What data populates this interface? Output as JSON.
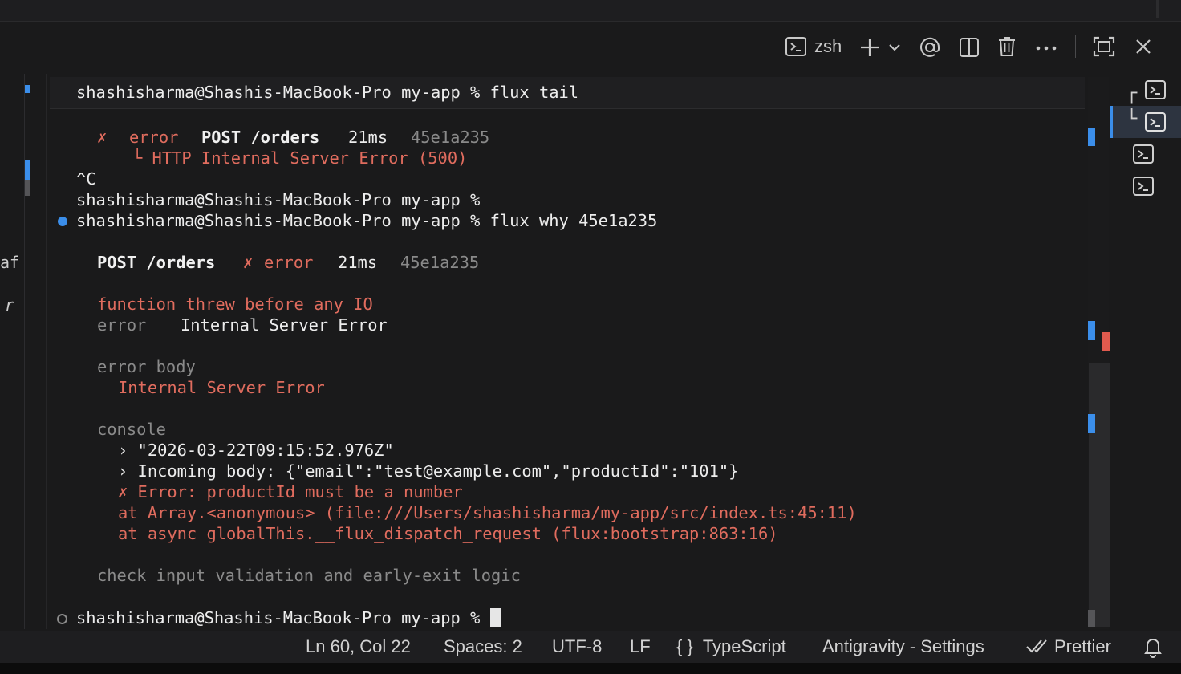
{
  "toolbar": {
    "shell_label": "zsh",
    "new_icon": "plus-icon",
    "dropdown_icon": "chevron-down-icon",
    "mention_icon": "at-icon",
    "split_icon": "split-icon",
    "trash_icon": "trash-icon",
    "more_icon": "ellipsis-icon",
    "maximize_icon": "maximize-icon",
    "close_icon": "close-icon"
  },
  "editor_edge": {
    "fragment_1": "af",
    "fragment_2": "r"
  },
  "terminal": {
    "sticky_prompt": "shashisharma@Shashis-MacBook-Pro my-app % flux tail",
    "tail": {
      "mark": "✗",
      "status": "error",
      "method_path": "POST /orders",
      "duration": "21ms",
      "id": "45e1a235",
      "detail": "└ HTTP Internal Server Error (500)"
    },
    "interrupt": "^C",
    "prompt_empty": "shashisharma@Shashis-MacBook-Pro my-app %",
    "prompt_why": "shashisharma@Shashis-MacBook-Pro my-app % flux why 45e1a235",
    "why": {
      "method_path": "POST /orders",
      "mark": "✗",
      "status": "error",
      "duration": "21ms",
      "id": "45e1a235",
      "headline": "function threw before any IO",
      "error_label": "error",
      "error_value": "Internal Server Error",
      "error_body_label": "error body",
      "error_body_value": "Internal Server Error",
      "console_label": "console",
      "console_1": "› \"2026-03-22T09:15:52.976Z\"",
      "console_2": "› Incoming body: {\"email\":\"test@example.com\",\"productId\":\"101\"}",
      "console_err": "✗ Error: productId must be a number",
      "stack_1": "at Array.<anonymous> (file:///Users/shashisharma/my-app/src/index.ts:45:11)",
      "stack_2": "at async globalThis.__flux_dispatch_request (flux:bootstrap:863:16)",
      "hint": "check input validation and early-exit logic"
    },
    "final_prompt": "shashisharma@Shashis-MacBook-Pro my-app %"
  },
  "terminal_list": {
    "items": [
      "terminal-1",
      "terminal-2",
      "terminal-3",
      "terminal-4"
    ],
    "active_index": 1
  },
  "status_bar": {
    "position": "Ln 60, Col 22",
    "spaces": "Spaces: 2",
    "encoding": "UTF-8",
    "eol": "LF",
    "language_icon": "{ }",
    "language": "TypeScript",
    "profile": "Antigravity - Settings",
    "formatter": "Prettier"
  },
  "colors": {
    "error_red": "#e06c5e",
    "decoration_blue": "#3b8eea",
    "background": "#1a1a1b"
  }
}
